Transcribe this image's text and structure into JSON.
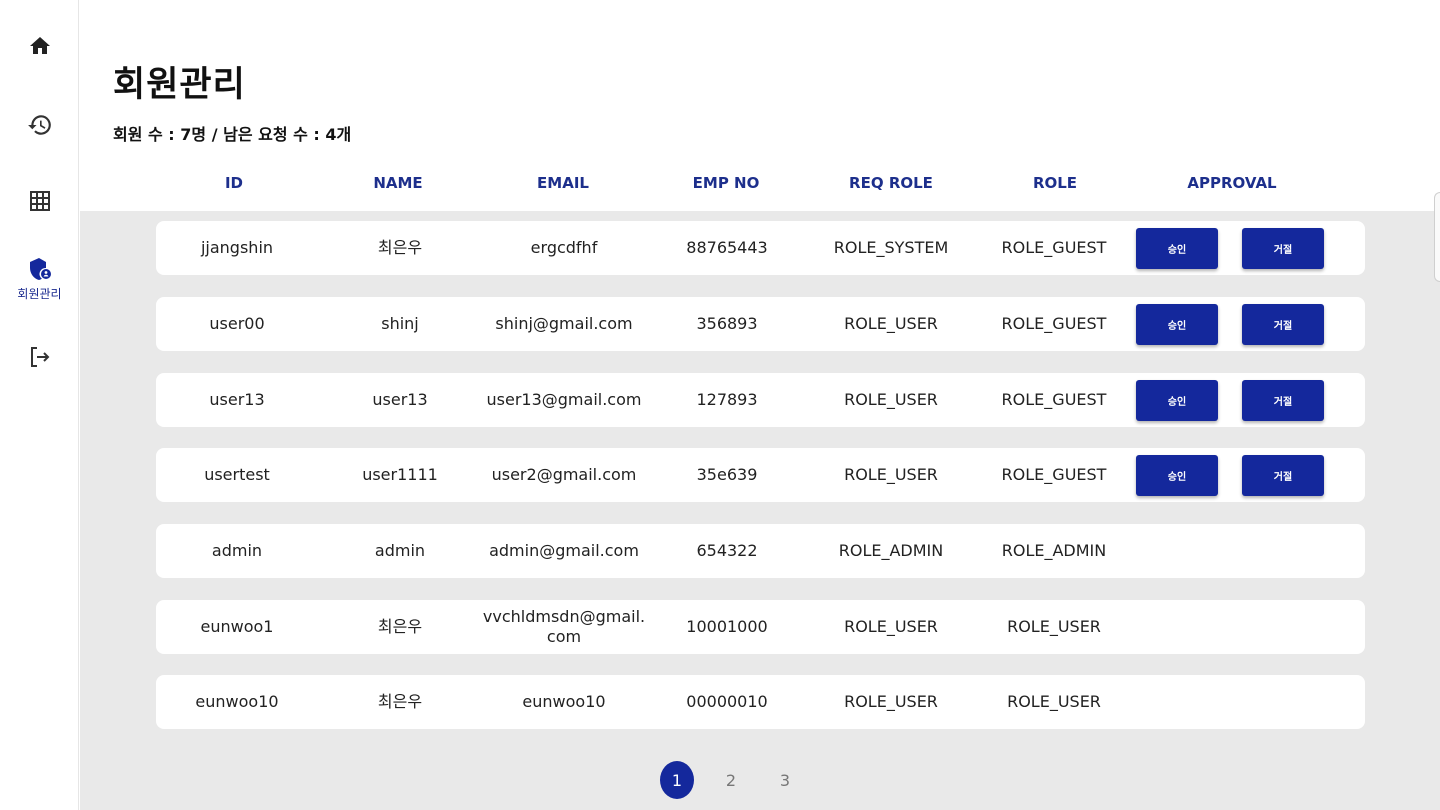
{
  "sidebar": {
    "items": [
      {
        "icon": "home-icon"
      },
      {
        "icon": "history-icon"
      },
      {
        "icon": "grid-icon"
      },
      {
        "icon": "shield-user-icon",
        "label": "회원관리"
      },
      {
        "icon": "logout-icon"
      }
    ]
  },
  "header": {
    "title": "회원관리",
    "summary": "회원 수 : 7명 / 남은 요청 수 : 4개"
  },
  "table": {
    "columns": [
      "ID",
      "NAME",
      "EMAIL",
      "EMP NO",
      "REQ ROLE",
      "ROLE",
      "APPROVAL"
    ],
    "approve_label": "승인",
    "reject_label": "거절",
    "rows": [
      {
        "id": "jjangshin",
        "name": "최은우",
        "email": "ergcdfhf",
        "emp_no": "88765443",
        "req_role": "ROLE_SYSTEM",
        "role": "ROLE_GUEST",
        "pending": true
      },
      {
        "id": "user00",
        "name": "shinj",
        "email": "shinj@gmail.com",
        "emp_no": "356893",
        "req_role": "ROLE_USER",
        "role": "ROLE_GUEST",
        "pending": true
      },
      {
        "id": "user13",
        "name": "user13",
        "email": "user13@gmail.com",
        "emp_no": "127893",
        "req_role": "ROLE_USER",
        "role": "ROLE_GUEST",
        "pending": true
      },
      {
        "id": "usertest",
        "name": "user1111",
        "email": "user2@gmail.com",
        "emp_no": "35e639",
        "req_role": "ROLE_USER",
        "role": "ROLE_GUEST",
        "pending": true
      },
      {
        "id": "admin",
        "name": "admin",
        "email": "admin@gmail.com",
        "emp_no": "654322",
        "req_role": "ROLE_ADMIN",
        "role": "ROLE_ADMIN",
        "pending": false
      },
      {
        "id": "eunwoo1",
        "name": "최은우",
        "email": "vvchldmsdn@gmail.com",
        "emp_no": "10001000",
        "req_role": "ROLE_USER",
        "role": "ROLE_USER",
        "pending": false
      },
      {
        "id": "eunwoo10",
        "name": "최은우",
        "email": "eunwoo10",
        "emp_no": "00000010",
        "req_role": "ROLE_USER",
        "role": "ROLE_USER",
        "pending": false
      }
    ]
  },
  "pagination": {
    "pages": [
      "1",
      "2",
      "3"
    ],
    "current": "1"
  },
  "colors": {
    "accent": "#14289c",
    "header_text": "#1d2f8c",
    "content_bg": "#e9e9e9"
  }
}
